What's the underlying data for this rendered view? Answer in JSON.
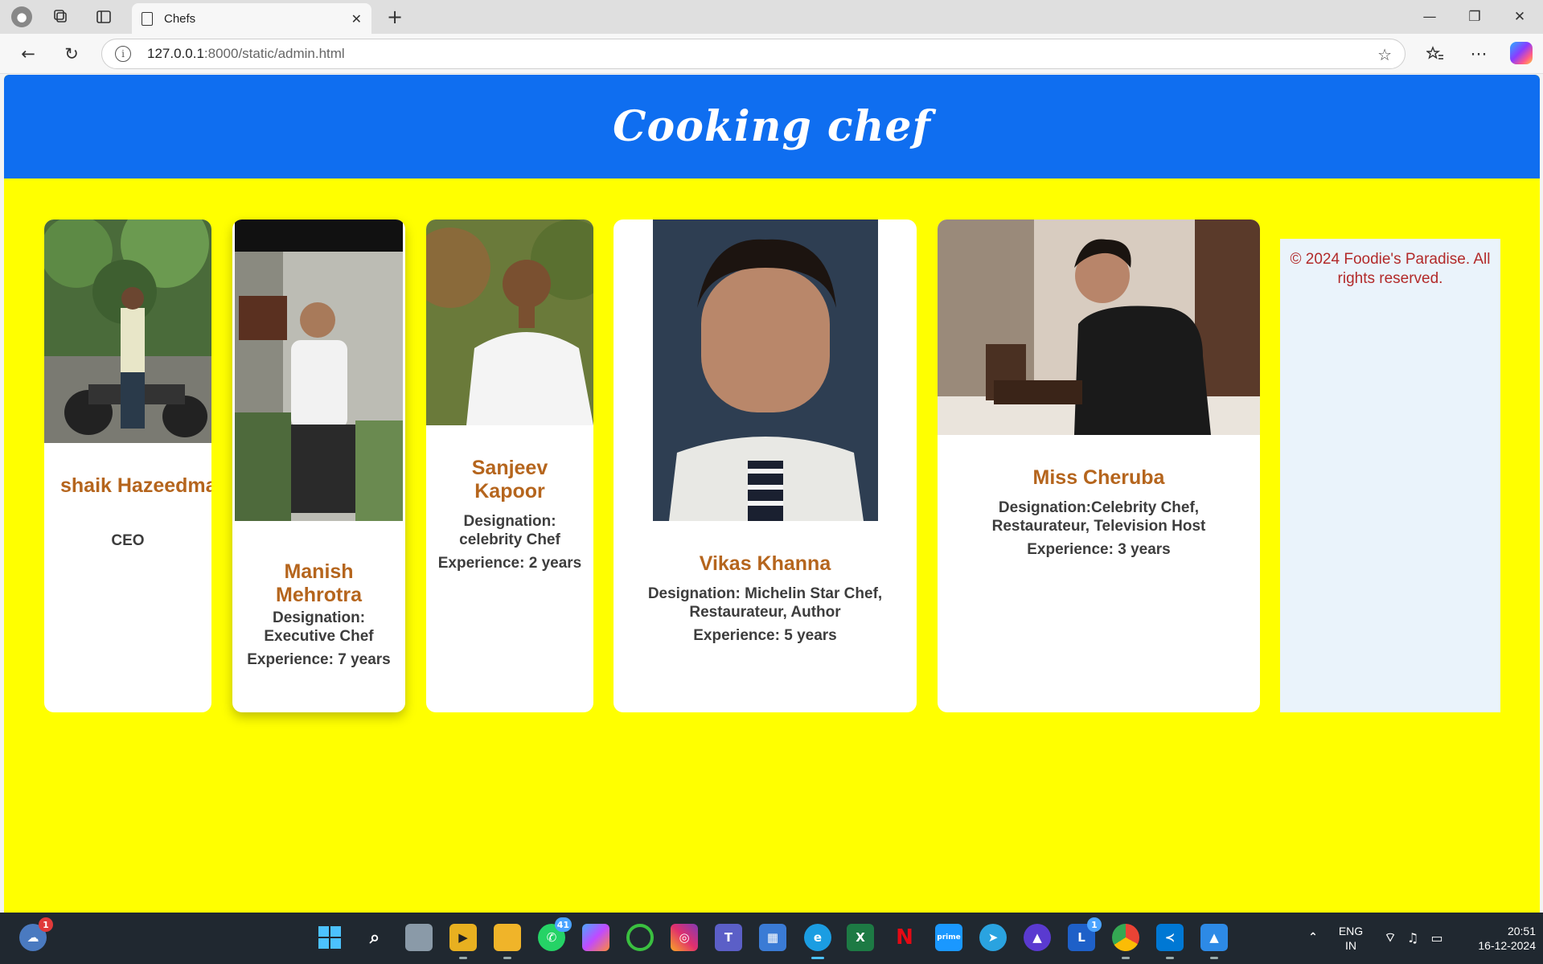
{
  "browser": {
    "tab_title": "Chefs",
    "tab_close": "✕",
    "new_tab": "+",
    "url_host": "127.0.0.1",
    "url_path": ":8000/static/admin.html",
    "win_minimize": "—",
    "win_restore": "❐",
    "win_close": "✕"
  },
  "header": {
    "title": "Cooking chef"
  },
  "chefs": [
    {
      "name": "shaik Hazeedmasthan",
      "designation": "CEO",
      "experience": ""
    },
    {
      "name": "Manish Mehrotra",
      "designation": "Designation: Executive Chef",
      "experience": "Experience: 7 years"
    },
    {
      "name": "Sanjeev Kapoor",
      "designation": "Designation: celebrity Chef",
      "experience": "Experience: 2 years"
    },
    {
      "name": "Vikas Khanna",
      "designation": "Designation: Michelin Star Chef, Restaurateur, Author",
      "experience": "Experience: 5 years"
    },
    {
      "name": "Miss Cheruba",
      "designation": "Designation:Celebrity Chef, Restaurateur, Television Host",
      "experience": "Experience: 3 years"
    }
  ],
  "footer": {
    "text": "© 2024 Foodie's Paradise. All rights reserved."
  },
  "taskbar": {
    "weather_badge": "1",
    "whatsapp_badge": "41",
    "linkedin_badge": "1",
    "lang_line1": "ENG",
    "lang_line2": "IN",
    "time": "20:51",
    "date": "16-12-2024"
  },
  "colors": {
    "page_bg": "#ffff00",
    "header_bg": "#0f6ef0",
    "chef_name": "#b5651d",
    "footer_text": "#b22a2a"
  }
}
